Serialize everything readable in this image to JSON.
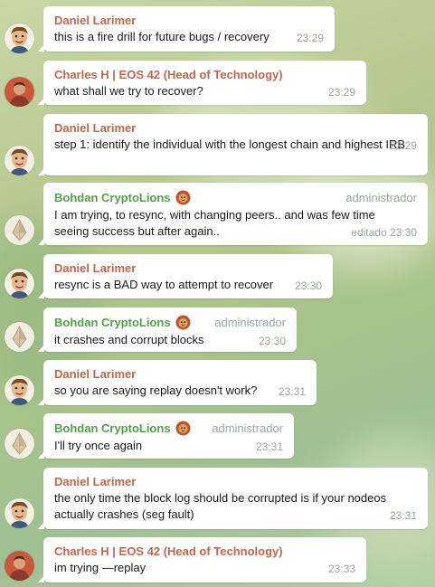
{
  "colors": {
    "sender_red": "#c0664a",
    "sender_green": "#54a04a",
    "meta": "#97a696"
  },
  "messages": [
    {
      "sender": "Daniel Larimer",
      "text": "this is a fire drill for future bugs / recovery",
      "time": "23:29"
    },
    {
      "sender": "Charles H | EOS 42 (Head of Technology)",
      "text": "what shall we try to recover?",
      "time": "23:29"
    },
    {
      "sender": "Daniel Larimer",
      "text": "step 1: identify the individual with the longest chain and highest IRB",
      "time": "23:29"
    },
    {
      "sender": "Bohdan CryptoLions",
      "role": "administrador",
      "text": "I am trying, to resync, with changing peers..   and was few time seeing success but after again..",
      "time": "editado 23:30"
    },
    {
      "sender": "Daniel Larimer",
      "text": "resync is a BAD way to attempt to recover",
      "time": "23:30"
    },
    {
      "sender": "Bohdan CryptoLions",
      "role": "administrador",
      "text": "it crashes and corrupt blocks",
      "time": "23:30"
    },
    {
      "sender": "Daniel Larimer",
      "text": "so you are saying replay doesn't work?",
      "time": "23:31"
    },
    {
      "sender": "Bohdan CryptoLions",
      "role": "administrador",
      "text": "I'll try once again",
      "time": "23:31"
    },
    {
      "sender": "Daniel Larimer",
      "text": "the only time the block log should be corrupted is if your nodeos actually crashes (seg fault)",
      "time": "23:31"
    },
    {
      "sender": "Charles H | EOS 42 (Head of Technology)",
      "text": "im trying —replay",
      "time": "23:33"
    }
  ]
}
